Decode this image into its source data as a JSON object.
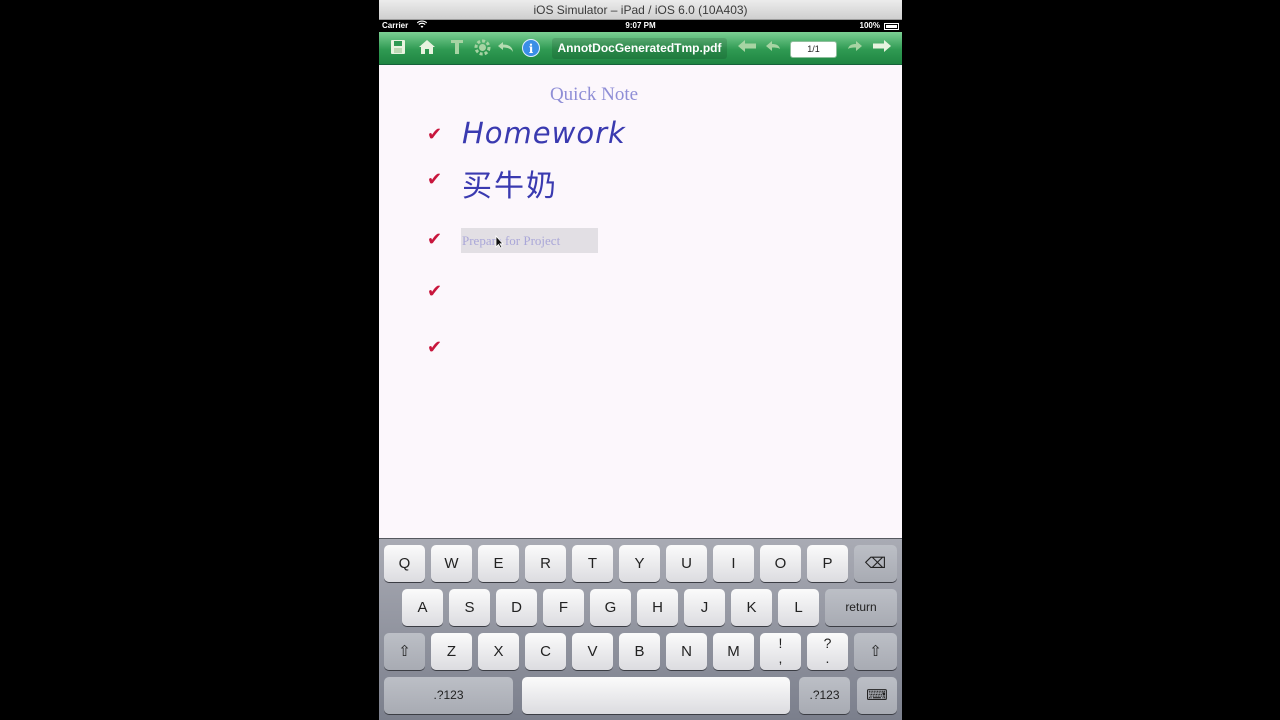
{
  "window": {
    "title": "iOS Simulator – iPad / iOS 6.0 (10A403)"
  },
  "status_bar": {
    "carrier": "Carrier",
    "time": "9:07 PM",
    "battery": "100%"
  },
  "toolbar": {
    "icons": [
      "save-icon",
      "home-icon",
      "text-icon",
      "settings-icon",
      "undo-icon",
      "info-icon",
      "back-arrow-icon",
      "previous-icon",
      "next-icon",
      "forward-arrow-icon"
    ],
    "info_glyph": "i",
    "doc_name": "AnnotDocGeneratedTmp.pdf",
    "page_indicator": "1/1"
  },
  "note": {
    "title": "Quick Note",
    "items": [
      {
        "checked": true,
        "text": "Homework",
        "style": "handwriting"
      },
      {
        "checked": true,
        "text": "买牛奶",
        "style": "handwriting"
      },
      {
        "checked": true,
        "placeholder": "Prepare for Project",
        "style": "input"
      },
      {
        "checked": true,
        "text": ""
      },
      {
        "checked": true,
        "text": ""
      }
    ],
    "check_glyph": "✔"
  },
  "keyboard": {
    "row1": [
      "Q",
      "W",
      "E",
      "R",
      "T",
      "Y",
      "U",
      "I",
      "O",
      "P"
    ],
    "row2": [
      "A",
      "S",
      "D",
      "F",
      "G",
      "H",
      "J",
      "K",
      "L"
    ],
    "row3": [
      "Z",
      "X",
      "C",
      "V",
      "B",
      "N",
      "M"
    ],
    "return_label": "return",
    "numbers_label": ".?123",
    "punct1": {
      "top": "!",
      "bottom": ","
    },
    "punct2": {
      "top": "?",
      "bottom": "."
    },
    "shift_glyph": "⇧",
    "delete_glyph": "⌫",
    "hide_keyboard_glyph": "⌨"
  },
  "colors": {
    "toolbar_green": "#2f9a52",
    "check_red": "#c8153c",
    "ink_blue": "#3a3ab0",
    "title_purple": "#8f8ed6"
  }
}
